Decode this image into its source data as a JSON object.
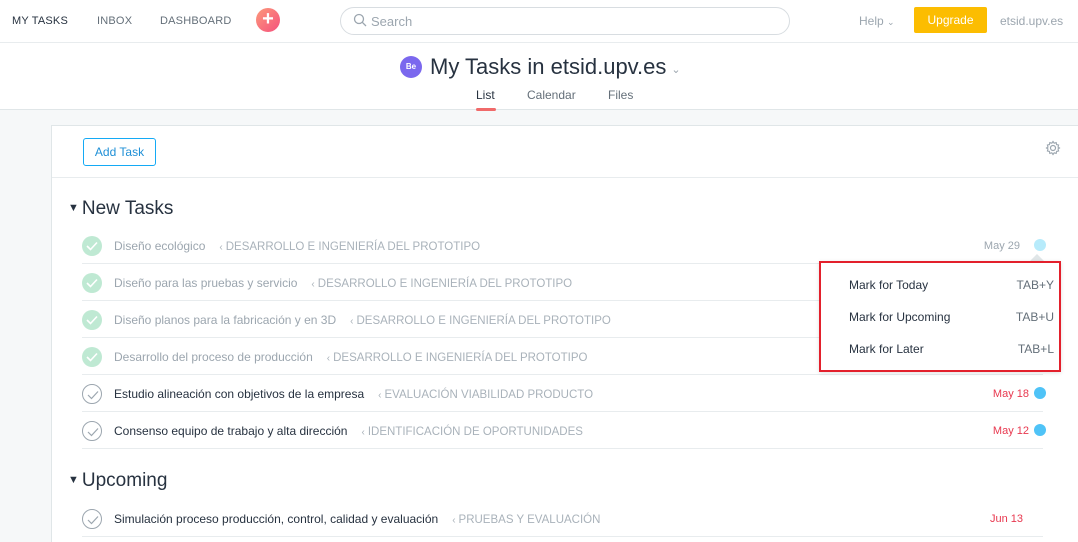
{
  "topbar": {
    "nav": [
      "MY TASKS",
      "INBOX",
      "DASHBOARD"
    ],
    "search_placeholder": "Search",
    "help": "Help",
    "upgrade": "Upgrade",
    "org": "etsid.upv.es"
  },
  "header": {
    "avatar": "Be",
    "title": "My Tasks in etsid.upv.es",
    "tabs": [
      "List",
      "Calendar",
      "Files"
    ],
    "active_tab": "List"
  },
  "toolbar": {
    "add_task": "Add Task"
  },
  "sections": [
    {
      "title": "New Tasks",
      "tasks": [
        {
          "name": "Diseño ecológico",
          "project": "DESARROLLO E INGENIERÍA DEL PROTOTIPO",
          "completed": true,
          "due": "May 29"
        },
        {
          "name": "Diseño para las pruebas y servicio",
          "project": "DESARROLLO E INGENIERÍA DEL PROTOTIPO",
          "completed": true,
          "due": ""
        },
        {
          "name": "Diseño planos para la fabricación y en 3D",
          "project": "DESARROLLO E INGENIERÍA DEL PROTOTIPO",
          "completed": true,
          "due": ""
        },
        {
          "name": "Desarrollo del proceso de producción",
          "project": "DESARROLLO E INGENIERÍA DEL PROTOTIPO",
          "completed": true,
          "due": ""
        },
        {
          "name": "Estudio alineación con objetivos de la empresa",
          "project": "EVALUACIÓN VIABILIDAD PRODUCTO",
          "completed": false,
          "due": "May 18"
        },
        {
          "name": "Consenso equipo de trabajo y alta dirección",
          "project": "IDENTIFICACIÓN DE OPORTUNIDADES",
          "completed": false,
          "due": "May 12"
        }
      ]
    },
    {
      "title": "Upcoming",
      "tasks": [
        {
          "name": "Simulación proceso producción, control, calidad y evaluación",
          "project": "PRUEBAS Y EVALUACIÓN",
          "completed": false,
          "due": "Jun 13"
        }
      ]
    }
  ],
  "popover": {
    "items": [
      {
        "label": "Mark for Today",
        "shortcut": "TAB+Y"
      },
      {
        "label": "Mark for Upcoming",
        "shortcut": "TAB+U"
      },
      {
        "label": "Mark for Later",
        "shortcut": "TAB+L"
      }
    ]
  },
  "colors": {
    "accent_red": "#e8384f",
    "upgrade": "#fcbd01",
    "link_blue": "#14aaf5",
    "dot_blue": "#4fc3f7",
    "popover_border": "#e3202c"
  },
  "icons": [
    "plus-icon",
    "search-icon",
    "chevron-down-icon",
    "gear-icon",
    "check-icon",
    "triangle-down-icon"
  ]
}
